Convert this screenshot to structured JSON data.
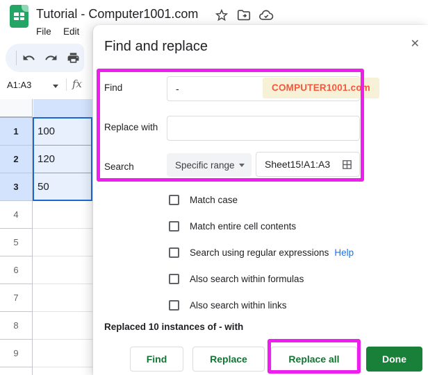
{
  "app": {
    "doc_title": "Tutorial - Computer1001.com",
    "menu_file": "File",
    "menu_edit": "Edit",
    "name_box": "A1:A3",
    "fx_label": "fx"
  },
  "grid": {
    "rows": [
      {
        "n": "1",
        "v": "100"
      },
      {
        "n": "2",
        "v": "120"
      },
      {
        "n": "3",
        "v": "50"
      },
      {
        "n": "4",
        "v": ""
      },
      {
        "n": "5",
        "v": ""
      },
      {
        "n": "6",
        "v": ""
      },
      {
        "n": "7",
        "v": ""
      },
      {
        "n": "8",
        "v": ""
      },
      {
        "n": "9",
        "v": ""
      }
    ]
  },
  "dialog": {
    "title": "Find and replace",
    "close_glyph": "✕",
    "find_label": "Find",
    "find_value": "-",
    "watermark": "COMPUTER1001.com",
    "replace_label": "Replace with",
    "replace_value": "",
    "search_label": "Search",
    "search_mode": "Specific range",
    "search_range": "Sheet15!A1:A3",
    "checkboxes": [
      {
        "label": "Match case"
      },
      {
        "label": "Match entire cell contents"
      },
      {
        "label": "Search using regular expressions",
        "link": "Help"
      },
      {
        "label": "Also search within formulas"
      },
      {
        "label": "Also search within links"
      }
    ],
    "status": "Replaced 10 instances of - with",
    "btn_find": "Find",
    "btn_replace": "Replace",
    "btn_replace_all": "Replace all",
    "btn_done": "Done"
  },
  "colors": {
    "highlight_magenta": "#ec1fec",
    "button_green": "#137333",
    "done_green": "#188038",
    "selection_blue": "#1967d2",
    "watermark_text": "#f4583d",
    "watermark_bg": "#f6f1d7",
    "link_blue": "#1a73e8",
    "selected_header_bg": "#d3e3fd",
    "selected_cell_bg": "#e8f0fe"
  }
}
